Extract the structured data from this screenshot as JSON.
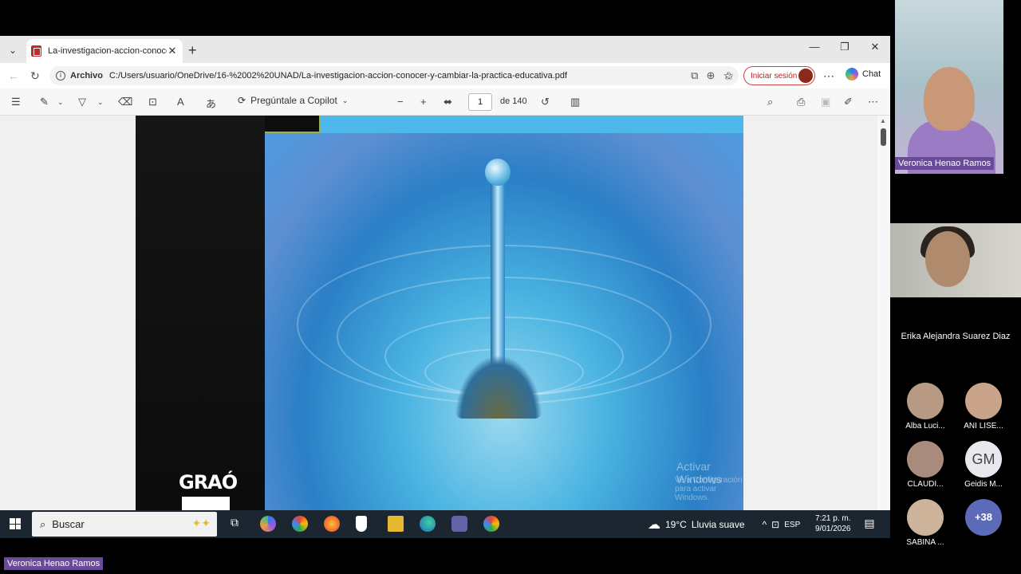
{
  "browser": {
    "tab_title": "La-investigacion-accion-conocer-y",
    "address_scheme": "Archivo",
    "address_path": "C:/Users/usuario/OneDrive/16-%2002%20UNAD/La-investigacion-accion-conocer-y-cambiar-la-practica-educativa.pdf",
    "signin_label": "Iniciar sesión",
    "chat_label": "Chat"
  },
  "pdf_toolbar": {
    "copilot_label": "Pregúntale a Copilot",
    "page_current": "1",
    "page_total": "de 140"
  },
  "document": {
    "publisher_logo_text": "GRAÓ",
    "watermark_title": "Activar Windows",
    "watermark_subtitle": "Ve a Configuración para activar Windows."
  },
  "taskbar": {
    "search_placeholder": "Buscar",
    "weather_temp": "19°C",
    "weather_desc": "Lluvia suave",
    "language": "ESP",
    "time": "7:21 p. m.",
    "date": "9/01/2026"
  },
  "meeting": {
    "main_speaker": "Veronica  Henao Ramos",
    "second_participant": "Erika Alejandra Suarez Diaz",
    "participants": [
      {
        "label": "Alba Luci...",
        "color": "#b89a84"
      },
      {
        "label": "ANI LISE...",
        "color": "#c9a48a"
      },
      {
        "label": "CLAUDI...",
        "color": "#a88b7d"
      },
      {
        "label": "Geidis M...",
        "initials": "GM"
      },
      {
        "label": "SABINA ...",
        "color": "#cdb39a"
      },
      {
        "label": "",
        "initials": "+38"
      }
    ],
    "presenter_label": "Veronica  Henao Ramos"
  }
}
